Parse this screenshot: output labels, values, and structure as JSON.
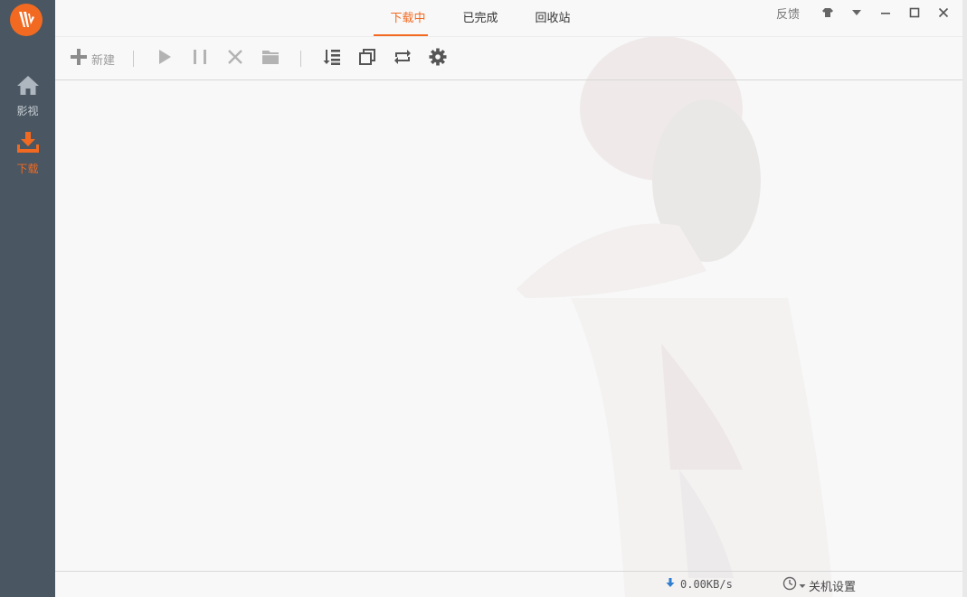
{
  "sidebar": {
    "logo": "app-logo",
    "items": [
      {
        "label": "影视",
        "icon": "home-icon"
      },
      {
        "label": "下载",
        "icon": "download-icon"
      }
    ]
  },
  "tabs": [
    {
      "label": "下载中"
    },
    {
      "label": "已完成"
    },
    {
      "label": "回收站"
    }
  ],
  "window": {
    "feedback_label": "反馈",
    "controls": [
      "skin-icon",
      "menu-arrow-icon",
      "minimize-icon",
      "maximize-icon",
      "close-icon"
    ]
  },
  "toolbar": {
    "new_label": "新建",
    "buttons": [
      "start-icon",
      "pause-icon",
      "delete-icon",
      "open-folder-icon",
      "list-icon",
      "copy-icon",
      "repeat-icon",
      "settings-icon"
    ]
  },
  "status": {
    "speed": "0.00KB/s",
    "shutdown_label": "关机设置"
  },
  "colors": {
    "accent": "#f26a21",
    "sidebar": "#4a5661"
  }
}
